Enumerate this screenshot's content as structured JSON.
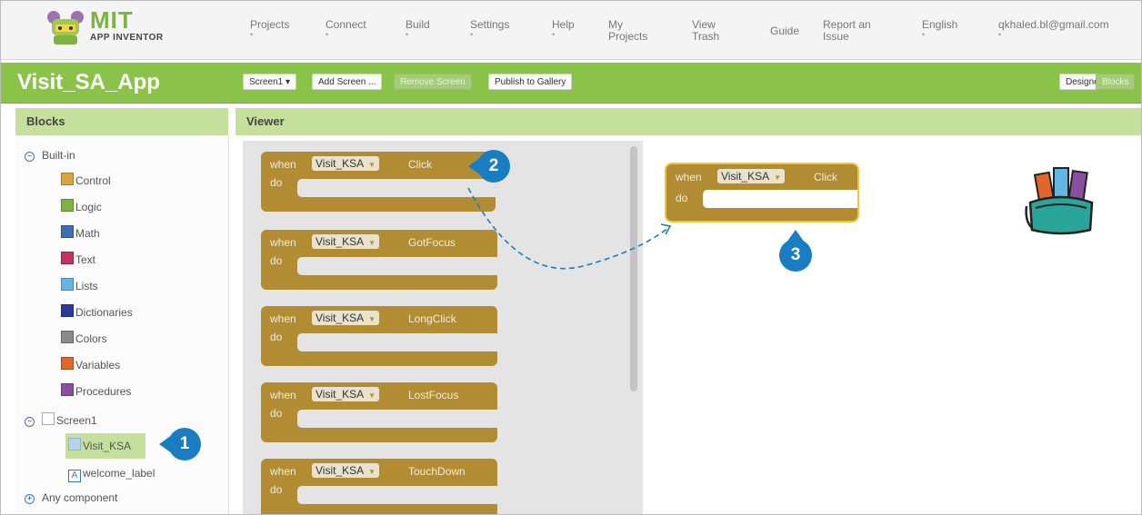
{
  "brand": {
    "name": "MIT",
    "sub": "APP INVENTOR"
  },
  "topnav": {
    "items": [
      {
        "label": "Projects",
        "dropdown": true
      },
      {
        "label": "Connect",
        "dropdown": true
      },
      {
        "label": "Build",
        "dropdown": true
      },
      {
        "label": "Settings",
        "dropdown": true
      },
      {
        "label": "Help",
        "dropdown": true
      },
      {
        "label": "My\nProjects"
      },
      {
        "label": "View\nTrash"
      },
      {
        "label": "Guide"
      },
      {
        "label": "Report an\nIssue"
      },
      {
        "label": "English",
        "dropdown": true
      },
      {
        "label": "qkhaled.bl@gmail.com",
        "dropdown": true
      }
    ],
    "dropdown_marker": "•"
  },
  "toolbar": {
    "project_name": "Visit_SA_App",
    "screen_select": "Screen1 ▾",
    "add_screen": "Add Screen ...",
    "remove_screen": "Remove Screen",
    "publish": "Publish to Gallery",
    "designer": "Designer",
    "blocks": "Blocks"
  },
  "blocks_panel": {
    "title": "Blocks",
    "builtin_label": "Built-in",
    "builtin": [
      {
        "label": "Control",
        "color": "#d9a544"
      },
      {
        "label": "Logic",
        "color": "#7cb342"
      },
      {
        "label": "Math",
        "color": "#3f6fb0"
      },
      {
        "label": "Text",
        "color": "#c2335f"
      },
      {
        "label": "Lists",
        "color": "#64b5e4"
      },
      {
        "label": "Dictionaries",
        "color": "#2a3a9a"
      },
      {
        "label": "Colors",
        "color": "#8a8a8a"
      },
      {
        "label": "Variables",
        "color": "#e0662a"
      },
      {
        "label": "Procedures",
        "color": "#8a4f9e"
      }
    ],
    "screen_label": "Screen1",
    "components": [
      {
        "label": "Visit_KSA",
        "selected": true
      },
      {
        "label": "welcome_label",
        "icon": "A"
      }
    ],
    "any_component": "Any component"
  },
  "viewer": {
    "title": "Viewer",
    "keyword_when": "when",
    "keyword_do": "do",
    "drawer_blocks": [
      {
        "component": "Visit_KSA",
        "event": "Click"
      },
      {
        "component": "Visit_KSA",
        "event": "GotFocus"
      },
      {
        "component": "Visit_KSA",
        "event": "LongClick"
      },
      {
        "component": "Visit_KSA",
        "event": "LostFocus"
      },
      {
        "component": "Visit_KSA",
        "event": "TouchDown"
      }
    ],
    "workspace_block": {
      "component": "Visit_KSA",
      "event": "Click"
    }
  },
  "callouts": [
    "1",
    "2",
    "3"
  ],
  "colors": {
    "brand_green": "#8bc34a",
    "event_block": "#b18c32",
    "callout_blue": "#1a7dc2",
    "selection_outline": "#f6c23e"
  },
  "icons": {
    "logo": "app-inventor-robot-icon",
    "backpack": "backpack-icon"
  }
}
